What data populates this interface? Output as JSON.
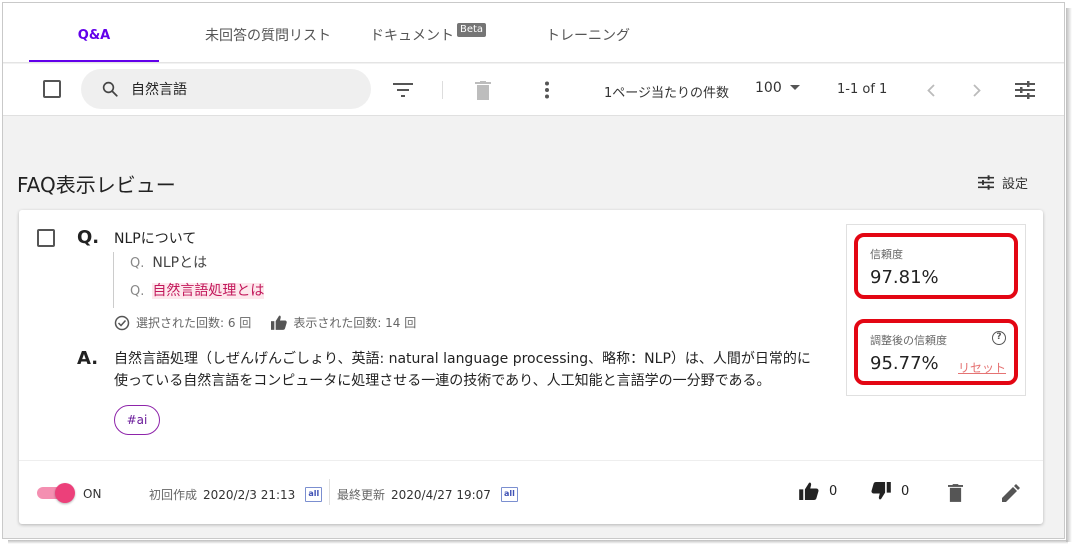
{
  "tabs": [
    {
      "label": "Q&A",
      "active": true
    },
    {
      "label": "未回答の質問リスト"
    },
    {
      "label": "ドキュメント",
      "badge": "Beta"
    },
    {
      "label": "トレーニング"
    }
  ],
  "toolbar": {
    "search_value": "自然言語",
    "per_page_label": "1ページ当たりの件数",
    "per_page_value": "100",
    "range": "1-1 of 1"
  },
  "header": {
    "title": "FAQ表示レビュー",
    "settings_label": "設定"
  },
  "faq": {
    "q_marker": "Q.",
    "question": "NLPについて",
    "alt_prefix": "Q.",
    "alt_questions": [
      {
        "text": "NLPとは",
        "highlighted": false
      },
      {
        "text": "自然言語処理とは",
        "highlighted": true
      }
    ],
    "selected_count": "選択された回数: 6 回",
    "displayed_count": "表示された回数: 14 回",
    "a_marker": "A.",
    "answer": "自然言語処理（しぜんげんごしょり、英語: natural language processing、略称：NLP）は、人間が日常的に使っている自然言語をコンピュータに処理させる一連の技術であり、人工知能と言語学の一分野である。",
    "tag": "#ai"
  },
  "confidence": {
    "label": "信頼度",
    "value": "97.81%",
    "adjusted_label": "調整後の信頼度",
    "adjusted_value": "95.77%",
    "reset_label": "リセット",
    "help_glyph": "?"
  },
  "footer": {
    "toggle_label": "ON",
    "created_label": "初回作成",
    "created_value": "2020/2/3 21:13",
    "updated_label": "最終更新",
    "updated_value": "2020/4/27 19:07",
    "ai_badge": "all",
    "likes": "0",
    "dislikes": "0"
  },
  "colors": {
    "accent": "#6200ea",
    "highlight_box": "#e30613",
    "toggle": "#ec407a"
  }
}
